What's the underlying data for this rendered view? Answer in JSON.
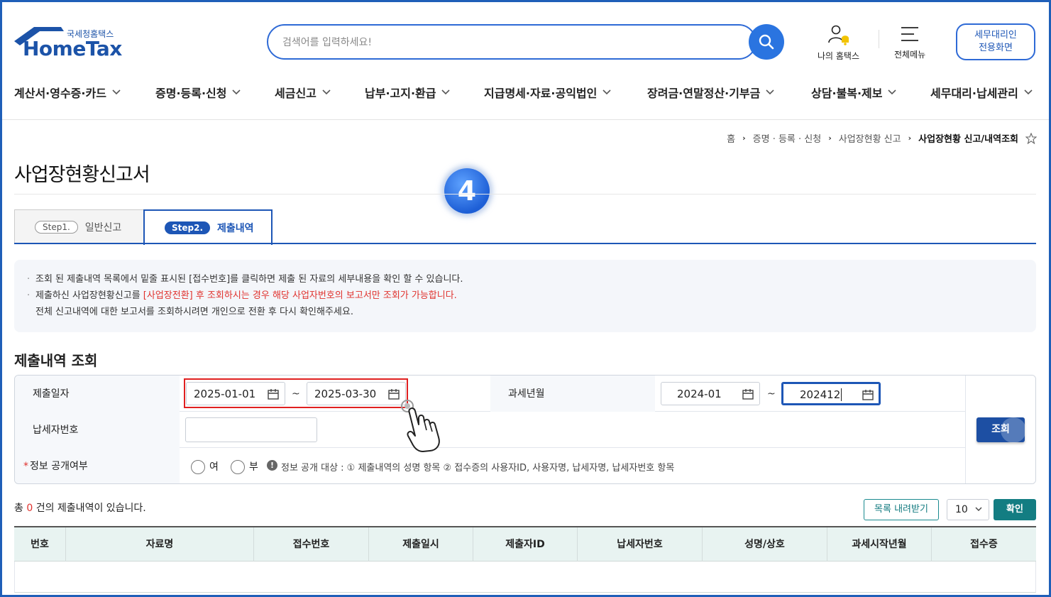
{
  "header": {
    "logo_sub": "국세청홈택스",
    "logo_main": "HomeTax",
    "search_placeholder": "검색어를 입력하세요!",
    "my_hometax": "나의 홈택스",
    "all_menu": "전체메뉴",
    "agent_btn_line1": "세무대리인",
    "agent_btn_line2": "전용화면"
  },
  "nav": [
    "계산서·영수증·카드",
    "증명·등록·신청",
    "세금신고",
    "납부·고지·환급",
    "지급명세·자료·공익법인",
    "장려금·연말정산·기부금",
    "상담·불복·제보",
    "세무대리·납세관리"
  ],
  "breadcrumb": {
    "home": "홈",
    "level1": "증명 · 등록 · 신청",
    "level2": "사업장현황 신고",
    "current": "사업장현황 신고/내역조회"
  },
  "page_title": "사업장현황신고서",
  "step_badge": "4",
  "tabs": [
    {
      "step": "Step1.",
      "label": "일반신고"
    },
    {
      "step": "Step2.",
      "label": "제출내역"
    }
  ],
  "notice": {
    "line1": "조회 된 제출내역 목록에서 밑줄 표시된 [접수번호]를 클릭하면 제출 된 자료의 세부내용을 확인 할 수 있습니다.",
    "line2_prefix": "제출하신 사업장현황신고를 ",
    "line2_red": "[사업장전환] 후 조회하시는 경우 해당 사업자번호의 보고서만 조회가 가능합니다.",
    "line3": "전체 신고내역에 대한 보고서를 조회하시려면 개인으로 전환 후 다시 확인해주세요."
  },
  "section_title": "제출내역 조회",
  "form": {
    "submit_date_label": "제출일자",
    "date_from": "2025-01-01",
    "date_to": "2025-03-30",
    "tax_period_label": "과세년월",
    "period_from": "2024-01",
    "period_to": "202412",
    "tilde": "~",
    "taxpayer_no_label": "납세자번호",
    "taxpayer_no_value": "",
    "disclosure_label": "정보 공개여부",
    "required_mark": "*",
    "option_yes": "여",
    "option_no": "부",
    "info_icon": "!",
    "disclosure_info": "정보 공개 대상 : ① 제출내역의 성명 항목 ② 접수증의 사용자ID, 사용자명, 납세자명, 납세자번호 항목",
    "search_button": "조회"
  },
  "results": {
    "total_prefix": "총 ",
    "total_count": "0",
    "total_suffix": " 건의 제출내역이 있습니다.",
    "download_button": "목록 내려받기",
    "page_size": "10",
    "confirm_button": "확인"
  },
  "table": {
    "headers": [
      "번호",
      "자료명",
      "접수번호",
      "제출일시",
      "제출자ID",
      "납세자번호",
      "성명/상호",
      "과세시작년월",
      "접수증"
    ]
  },
  "colors": {
    "brand_blue": "#1d56b6",
    "accent_teal": "#137d82",
    "highlight_red": "#e02020"
  }
}
